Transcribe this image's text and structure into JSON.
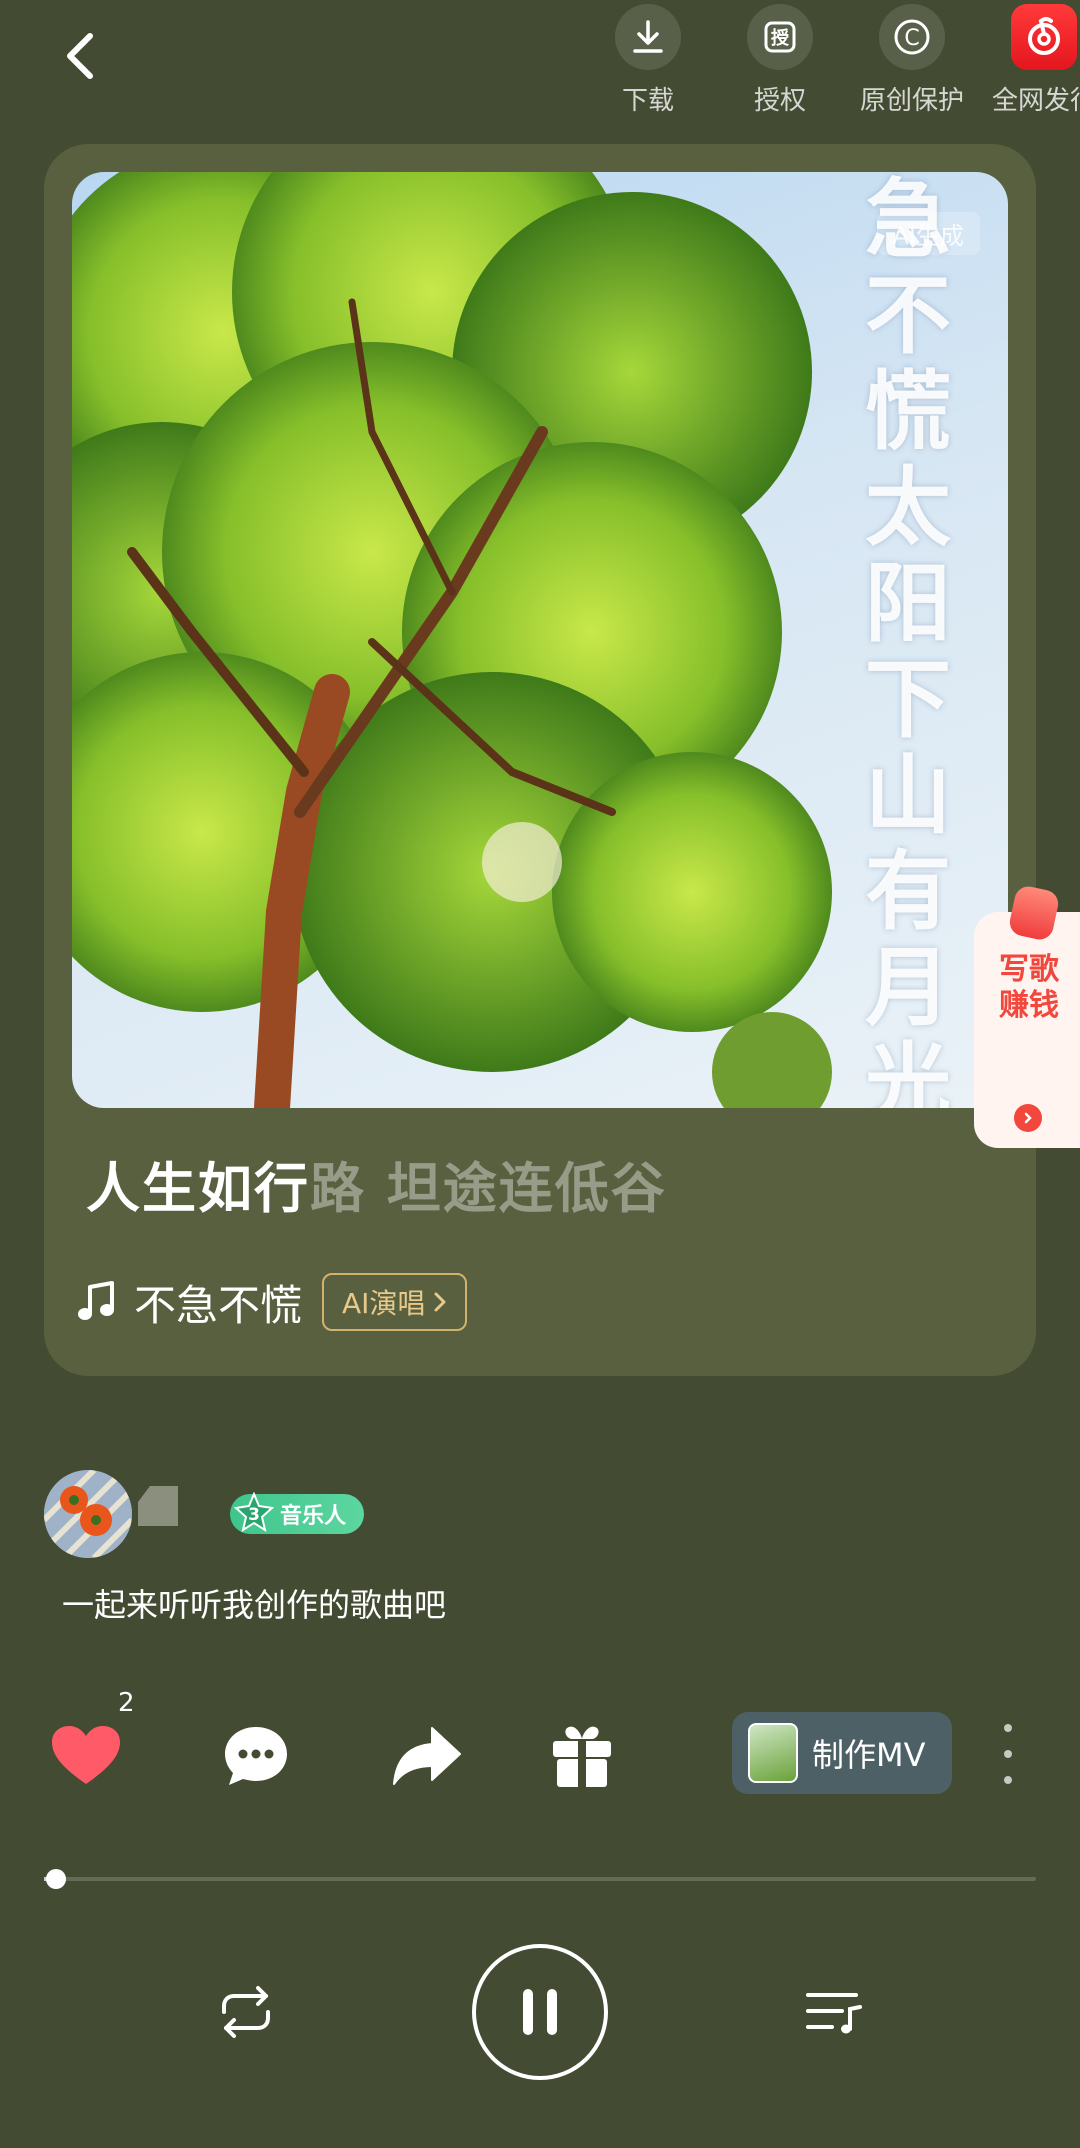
{
  "top_actions": [
    {
      "label": "下载",
      "icon": "download-icon"
    },
    {
      "label": "授权",
      "icon": "license-icon",
      "glyph": "授"
    },
    {
      "label": "原创保护",
      "icon": "copyright-icon",
      "glyph": "C"
    },
    {
      "label": "全网发行",
      "icon": "netease-music-icon"
    }
  ],
  "cover": {
    "ai_tag": "AI生成",
    "title_text": "急不慌太阳下山有月光"
  },
  "lyric": {
    "sung": "人生如行",
    "unsung": "路 坦途连低谷"
  },
  "song": {
    "name": "不急不慌",
    "ai_sing_label": "AI演唱"
  },
  "write_song_widget": {
    "label": "写歌赚钱"
  },
  "author": {
    "badge_level": "3",
    "badge_label": "音乐人",
    "post_text": "一起来听听我创作的歌曲吧"
  },
  "actions": {
    "like_count": "2",
    "make_mv_label": "制作MV"
  },
  "player": {
    "progress_fraction": 0.012,
    "state": "playing"
  },
  "colors": {
    "background": "#434b32",
    "card": "#58603f",
    "like": "#ff5a67",
    "accent_gold": "#e9c98a",
    "brand_red": "#e4161e",
    "badge_green": "#3fc58c"
  }
}
